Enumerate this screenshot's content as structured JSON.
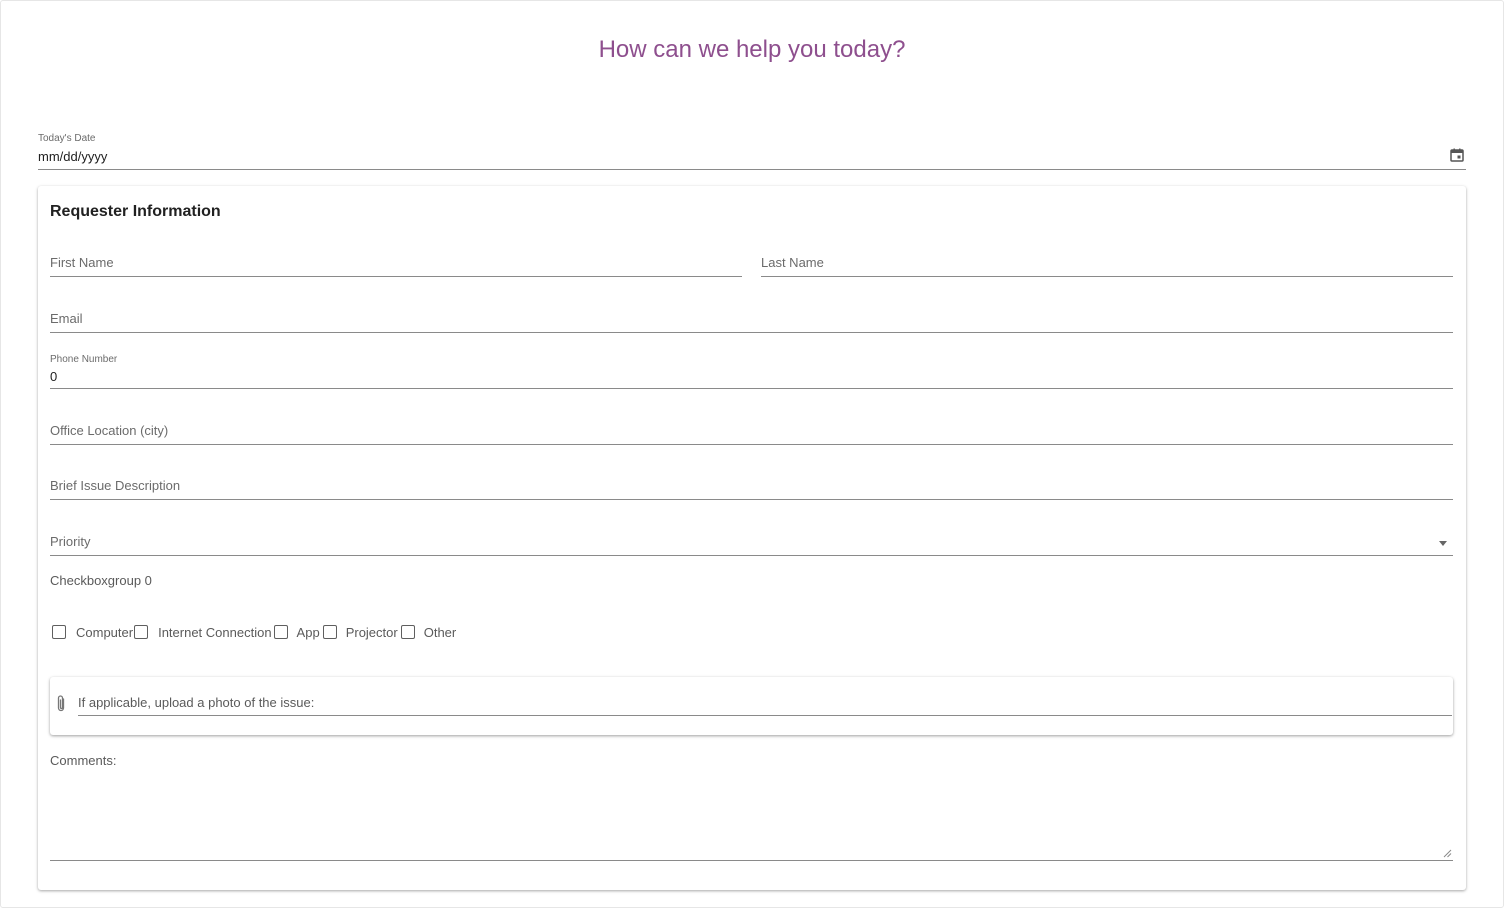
{
  "header": {
    "title": "How can we help you today?"
  },
  "date_field": {
    "label": "Today's Date",
    "value": "mm/dd/yyyy",
    "icon": "calendar-icon"
  },
  "card": {
    "title": "Requester Information",
    "fields": {
      "first_name": {
        "placeholder": "First Name"
      },
      "last_name": {
        "placeholder": "Last Name"
      },
      "email": {
        "placeholder": "Email"
      },
      "phone": {
        "label": "Phone Number",
        "value": "0"
      },
      "office": {
        "placeholder": "Office Location (city)"
      },
      "issue": {
        "placeholder": "Brief Issue Description"
      },
      "priority": {
        "placeholder": "Priority"
      }
    },
    "checkbox_group": {
      "label": "Checkboxgroup 0",
      "options": [
        "Computer",
        "Internet Connection",
        "App",
        "Projector",
        "Other"
      ]
    },
    "upload": {
      "label": "If applicable, upload a photo of the issue:",
      "icon": "paperclip-icon"
    },
    "comments": {
      "label": "Comments:"
    }
  }
}
